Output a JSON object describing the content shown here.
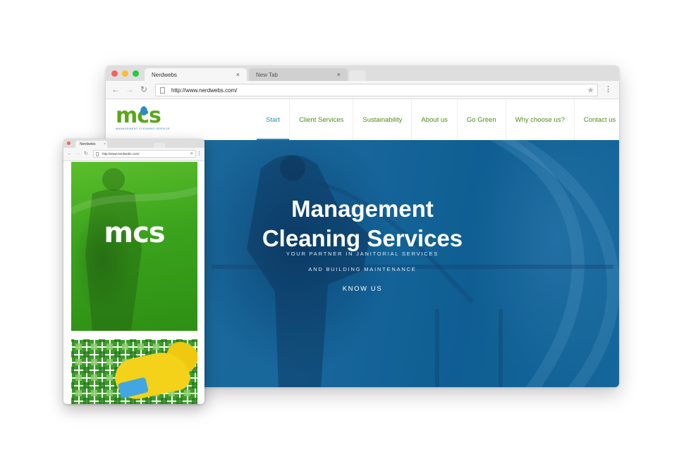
{
  "desktop": {
    "tabs": [
      {
        "label": "Nerdwebs",
        "close": "×"
      },
      {
        "label": "New Tab",
        "close": "×"
      }
    ],
    "url": "http://www.nerdwebs.com/",
    "nav_glyphs": {
      "back": "←",
      "forward": "→",
      "reload": "↻",
      "menu": "⋮",
      "star": "★"
    }
  },
  "site": {
    "logo": {
      "text": "mcs",
      "tagline": "MANAGEMENT CLEANING SERVICE"
    },
    "nav": [
      {
        "label": "Start"
      },
      {
        "label": "Client Services"
      },
      {
        "label": "Sustainability"
      },
      {
        "label": "About us"
      },
      {
        "label": "Go Green"
      },
      {
        "label": "Why choose us?"
      },
      {
        "label": "Contact us"
      }
    ],
    "hero": {
      "title_line1": "Management",
      "title_line2": "Cleaning Services",
      "subtitle_line1": "YOUR PARTNER IN JANITORIAL SERVICES",
      "subtitle_line2": "AND BUILDING MAINTENANCE",
      "cta": "KNOW US"
    }
  },
  "mobile": {
    "tab_label": "Nerdwebs",
    "tab_close": "×",
    "url": "http://www.nerdwebs.com/",
    "logo": "mcs"
  },
  "colors": {
    "brand_green": "#5aa61a",
    "brand_blue": "#2d8bbf",
    "hero_blue": "#1a6a9f"
  }
}
